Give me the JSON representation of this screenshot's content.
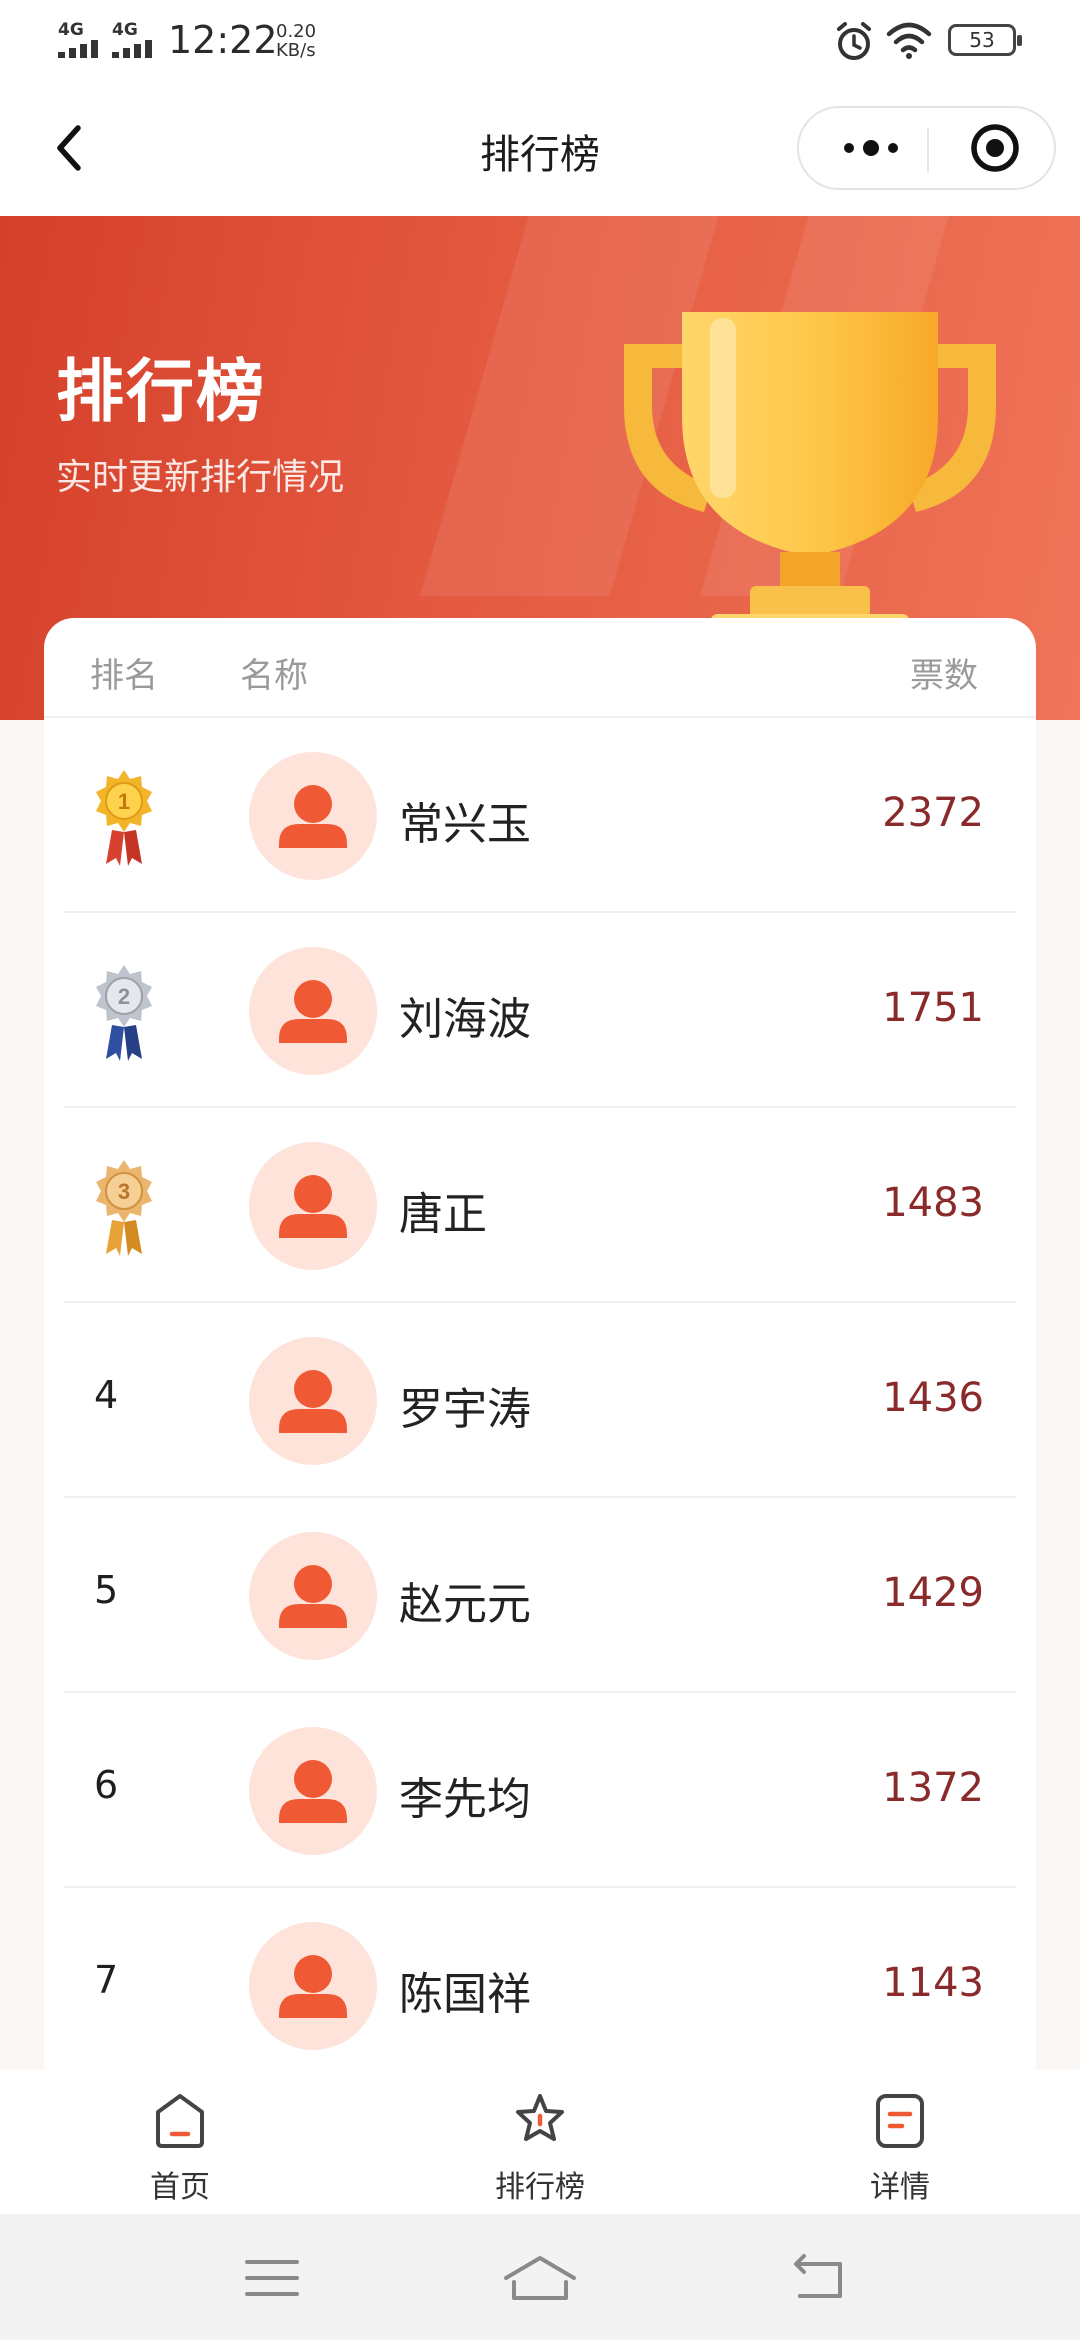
{
  "status_bar": {
    "signal_1": "4G",
    "signal_2": "4G",
    "time": "12:22",
    "net_speed_value": "0.20",
    "net_speed_unit": "KB/s",
    "battery": "53"
  },
  "nav": {
    "title": "排行榜"
  },
  "banner": {
    "title": "排行榜",
    "subtitle": "实时更新排行情况"
  },
  "table": {
    "headers": {
      "rank": "排名",
      "name": "名称",
      "votes": "票数"
    },
    "rows": [
      {
        "rank": "1",
        "name": "常兴玉",
        "votes": "2372",
        "medal": "gold"
      },
      {
        "rank": "2",
        "name": "刘海波",
        "votes": "1751",
        "medal": "silver"
      },
      {
        "rank": "3",
        "name": "唐正",
        "votes": "1483",
        "medal": "bronze"
      },
      {
        "rank": "4",
        "name": "罗宇涛",
        "votes": "1436"
      },
      {
        "rank": "5",
        "name": "赵元元",
        "votes": "1429"
      },
      {
        "rank": "6",
        "name": "李先均",
        "votes": "1372"
      },
      {
        "rank": "7",
        "name": "陈国祥",
        "votes": "1143"
      }
    ]
  },
  "tabs": [
    {
      "label": "首页",
      "icon": "home-icon"
    },
    {
      "label": "排行榜",
      "icon": "star-icon"
    },
    {
      "label": "详情",
      "icon": "document-icon"
    }
  ],
  "colors": {
    "accent": "#ef5a34",
    "banner": "#e04a32",
    "votes": "#8a2a2a"
  }
}
